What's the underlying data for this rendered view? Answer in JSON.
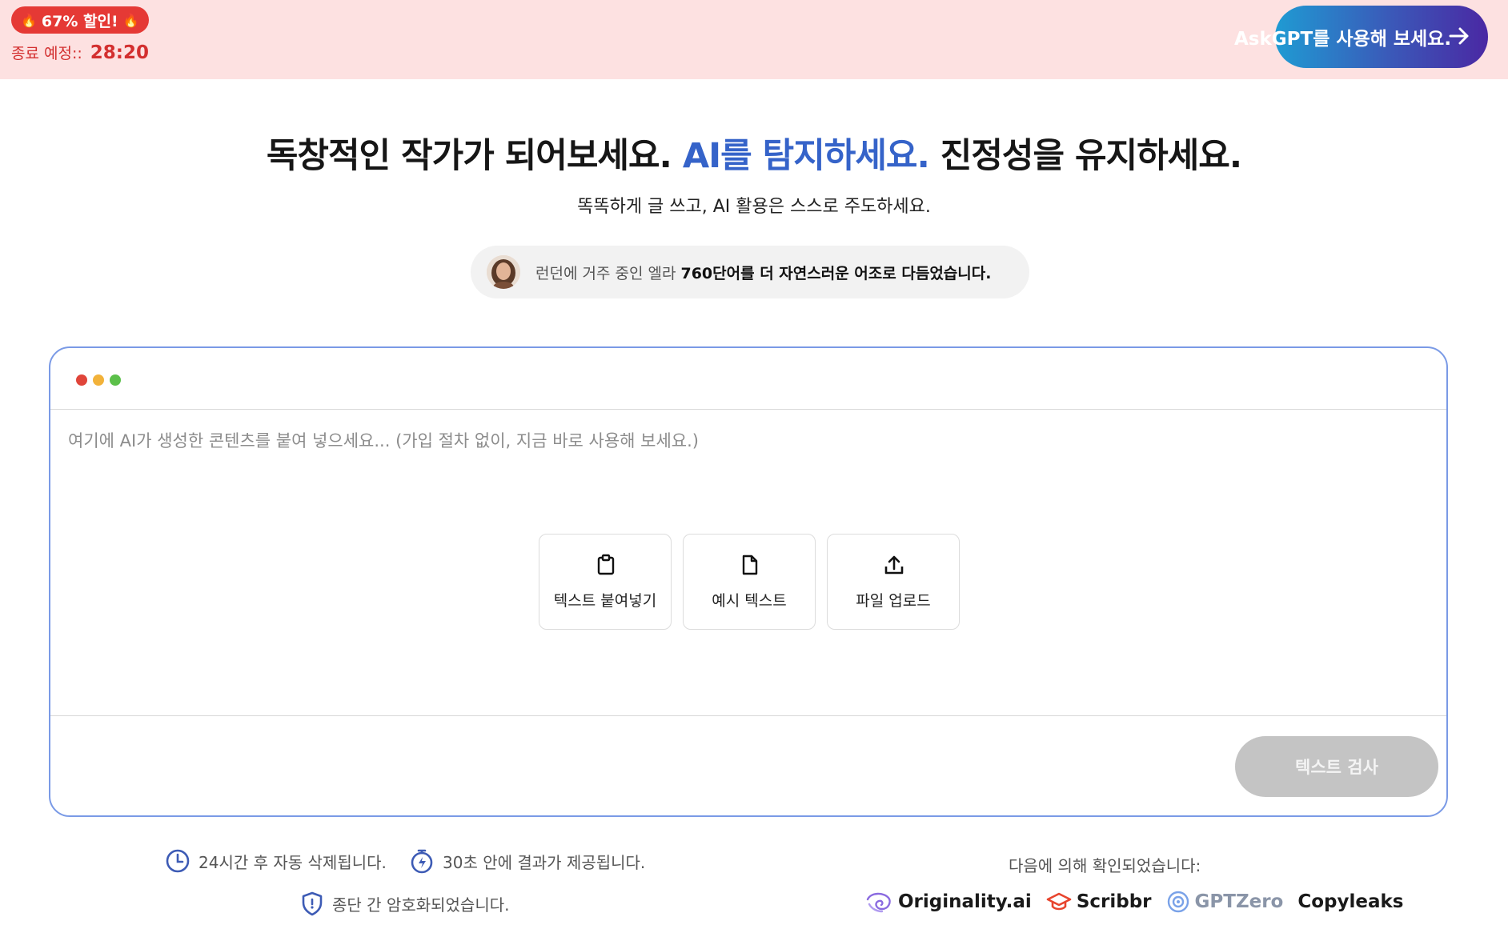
{
  "promo": {
    "badge": "67% 할인!",
    "ends_label": "종료 예정::",
    "timer": "28:20",
    "cta_label": "AskGPT를 사용해 보세요."
  },
  "hero": {
    "title_part1": "독창적인 작가가 되어보세요. ",
    "title_accent": "AI를 탐지하세요.",
    "title_part2": " 진정성을 유지하세요.",
    "subtitle": "똑똑하게 글 쓰고, AI 활용은 스스로 주도하세요.",
    "testimonial_muted": "런던에 거주 중인 엘라 ",
    "testimonial_strong": "760단어를 더 자연스러운 어조로 다듬었습니다."
  },
  "editor": {
    "placeholder": "여기에 AI가 생성한 콘텐츠를 붙여 넣으세요... (가입 절차 없이, 지금 바로 사용해 보세요.)",
    "actions": [
      {
        "label": "텍스트 붙여넣기",
        "icon": "clipboard-icon"
      },
      {
        "label": "예시 텍스트",
        "icon": "document-icon"
      },
      {
        "label": "파일 업로드",
        "icon": "upload-icon"
      }
    ],
    "check_label": "텍스트 검사",
    "window_dots": [
      "#e0453a",
      "#f2b23a",
      "#5cc04a"
    ]
  },
  "features": {
    "auto_delete": "24시간 후 자동 삭제됩니다.",
    "results_time": "30초 안에 결과가 제공됩니다.",
    "encrypted": "종단 간 암호화되었습니다."
  },
  "verified": {
    "label": "다음에 의해 확인되었습니다:",
    "logos": [
      "Originality.ai",
      "Scribbr",
      "GPTZero",
      "Copyleaks"
    ]
  },
  "colors": {
    "accent": "#3563c9",
    "promo_bg": "#fde1e1",
    "badge_red": "#e53935",
    "card_border": "#7a9ae6"
  }
}
